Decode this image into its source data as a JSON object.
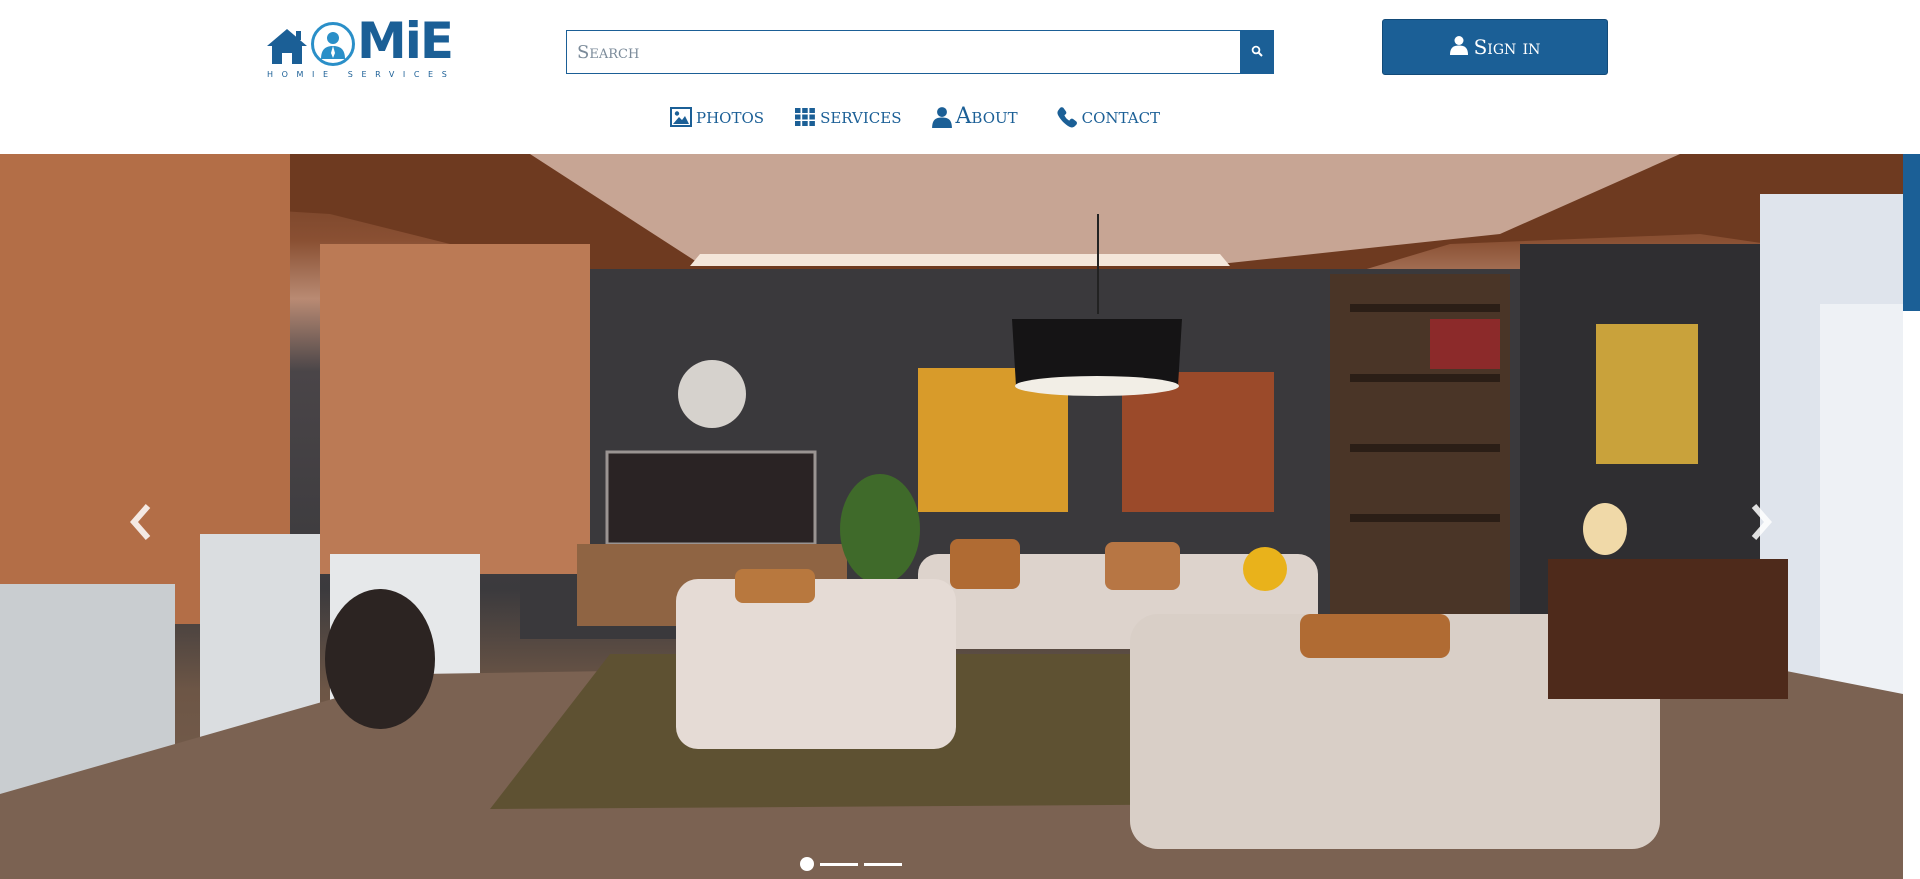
{
  "brand": {
    "logo_word": "MiE",
    "logo_sub": "HOMIE SERVICES",
    "accent": "#1b5f96",
    "accent_light": "#2a8fc8"
  },
  "search": {
    "placeholder": "Search",
    "icon": "search-icon"
  },
  "header": {
    "signin_label": "Sign in",
    "signin_icon": "user-icon"
  },
  "nav": {
    "items": [
      {
        "label": "photos",
        "icon": "image-icon"
      },
      {
        "label": "services",
        "icon": "grid-icon"
      },
      {
        "label": "About",
        "icon": "user-icon"
      },
      {
        "label": "contact",
        "icon": "phone-icon"
      }
    ]
  },
  "carousel": {
    "prev_icon": "chevron-left-icon",
    "next_icon": "chevron-right-icon",
    "slides": 3,
    "active_slide": 1
  }
}
